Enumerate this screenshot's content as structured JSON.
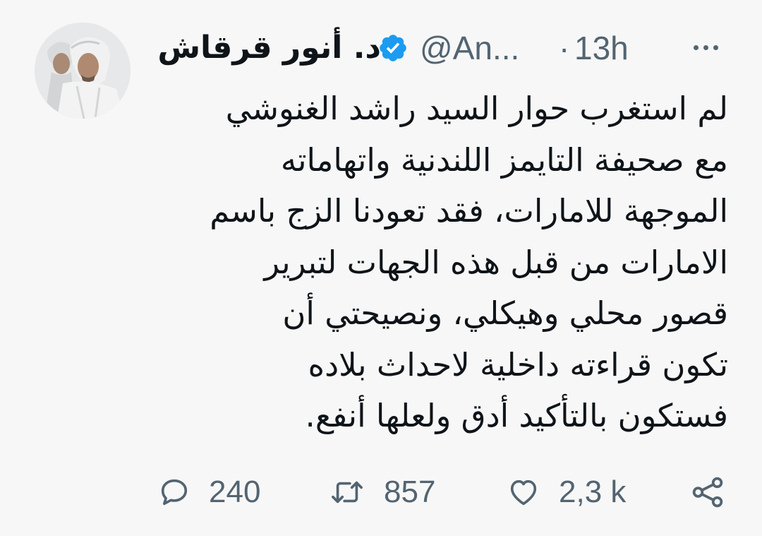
{
  "author": {
    "display_name": "د. أنور قرقاش",
    "handle": "@An...",
    "separator": "·",
    "timestamp": "13h",
    "verified": true
  },
  "tweet": {
    "lines": [
      "لم استغرب حوار السيد راشد الغنوشي",
      "مع صحيفة التايمز اللندنية واتهاماته",
      "الموجهة للامارات، فقد تعودنا الزج باسم",
      "الامارات من قبل هذه الجهات لتبرير",
      "قصور محلي وهيكلي، ونصيحتي أن",
      "تكون قراءته داخلية لاحداث بلاده",
      "فستكون بالتأكيد أدق ولعلها أنفع."
    ]
  },
  "actions": {
    "reply_count": "240",
    "retweet_count": "857",
    "like_count": "2,3 k"
  },
  "icons": {
    "verified": "verified-badge-icon",
    "more": "more-dots-icon",
    "reply": "reply-bubble-icon",
    "retweet": "retweet-arrows-icon",
    "like": "heart-icon",
    "share": "share-icon"
  },
  "colors": {
    "background": "#f7f7f7",
    "text": "#0f1419",
    "secondary_text": "#536471",
    "verified": "#1d9bf0"
  }
}
